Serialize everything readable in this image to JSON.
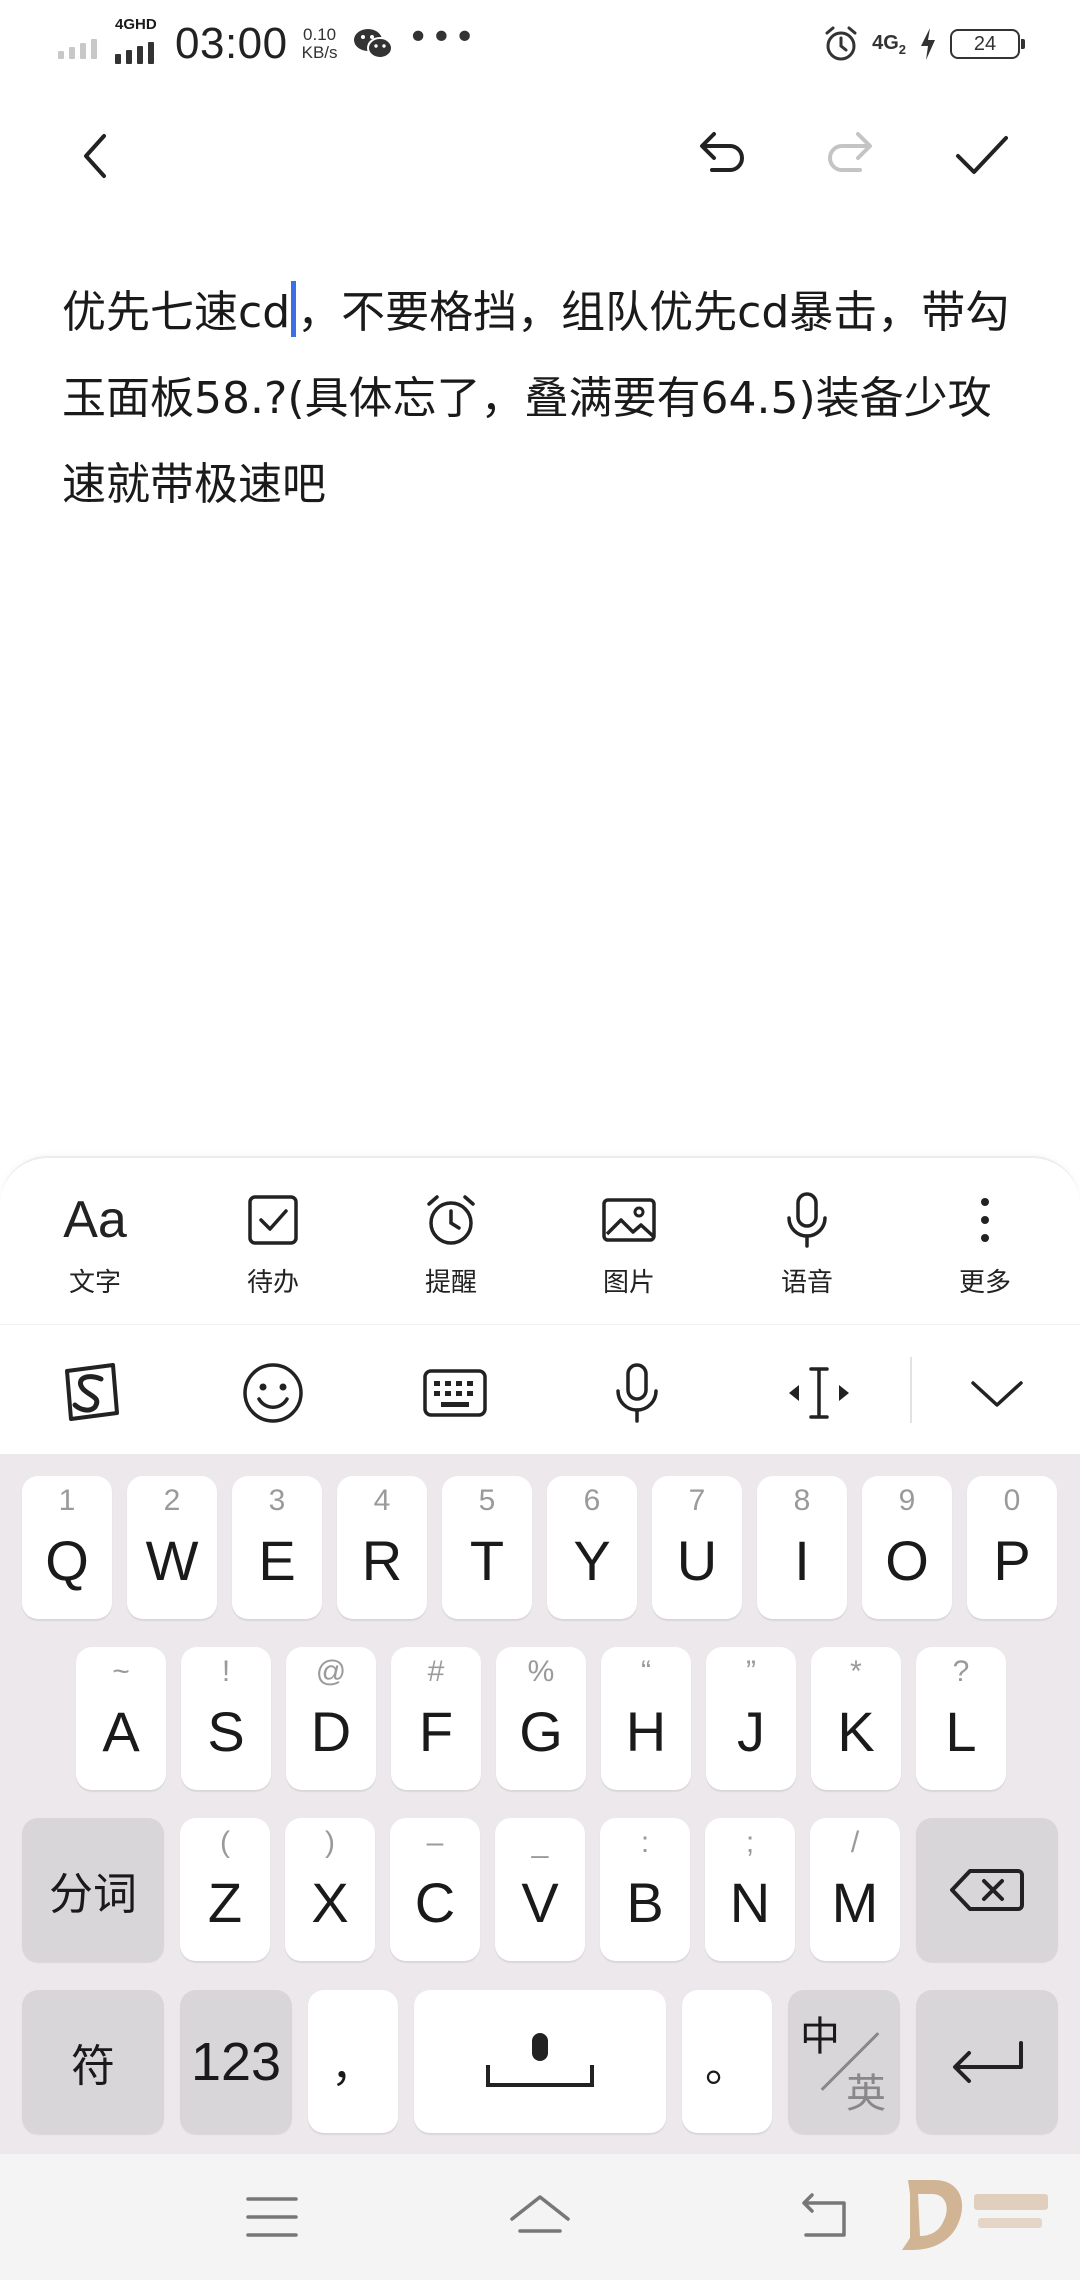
{
  "status_bar": {
    "network_tag": "4GHD",
    "time": "03:00",
    "speed_value": "0.10",
    "speed_unit": "KB/s",
    "more_indicator": "•••",
    "network_right": "4G",
    "network_right_sub": "2",
    "battery": "24",
    "icons": [
      "signal-icon",
      "wechat-icon",
      "alarm-icon",
      "charging-icon",
      "battery-icon"
    ]
  },
  "toolbar": {
    "back": "back-icon",
    "undo": "undo-icon",
    "redo": "redo-icon",
    "done": "check-icon"
  },
  "note": {
    "text_before_cursor": "优先七速cd",
    "text_after_cursor": "，不要格挡，组队优先cd暴击，带勾玉面板58.?(具体忘了，叠满要有64.5)装备少攻速就带极速吧",
    "cursor_color": "#3a6fe8"
  },
  "format_bar": {
    "items": [
      {
        "label": "文字",
        "icon": "text-style-icon",
        "glyph": "Aa"
      },
      {
        "label": "待办",
        "icon": "checkbox-icon"
      },
      {
        "label": "提醒",
        "icon": "alarm-clock-icon"
      },
      {
        "label": "图片",
        "icon": "image-icon"
      },
      {
        "label": "语音",
        "icon": "microphone-icon"
      },
      {
        "label": "更多",
        "icon": "more-vertical-icon"
      }
    ]
  },
  "keyboard_tools": [
    "sogou-logo-icon",
    "emoji-icon",
    "keyboard-icon",
    "voice-input-icon",
    "cursor-move-icon",
    "collapse-keyboard-icon"
  ],
  "keyboard": {
    "row1": [
      {
        "hint": "1",
        "key": "Q"
      },
      {
        "hint": "2",
        "key": "W"
      },
      {
        "hint": "3",
        "key": "E"
      },
      {
        "hint": "4",
        "key": "R"
      },
      {
        "hint": "5",
        "key": "T"
      },
      {
        "hint": "6",
        "key": "Y"
      },
      {
        "hint": "7",
        "key": "U"
      },
      {
        "hint": "8",
        "key": "I"
      },
      {
        "hint": "9",
        "key": "O"
      },
      {
        "hint": "0",
        "key": "P"
      }
    ],
    "row2": [
      {
        "hint": "~",
        "key": "A"
      },
      {
        "hint": "!",
        "key": "S"
      },
      {
        "hint": "@",
        "key": "D"
      },
      {
        "hint": "#",
        "key": "F"
      },
      {
        "hint": "%",
        "key": "G"
      },
      {
        "hint": "“",
        "key": "H"
      },
      {
        "hint": "”",
        "key": "J"
      },
      {
        "hint": "*",
        "key": "K"
      },
      {
        "hint": "?",
        "key": "L"
      }
    ],
    "row3": [
      {
        "hint": "(",
        "key": "Z"
      },
      {
        "hint": ")",
        "key": "X"
      },
      {
        "hint": "–",
        "key": "C"
      },
      {
        "hint": "_",
        "key": "V"
      },
      {
        "hint": ":",
        "key": "B"
      },
      {
        "hint": ";",
        "key": "N"
      },
      {
        "hint": "/",
        "key": "M"
      }
    ],
    "segment_label": "分词",
    "symbols_label": "符",
    "numbers_label": "123",
    "comma": "，",
    "period": "。",
    "lang_zh": "中",
    "lang_en": "英"
  },
  "navbar": {
    "menu": "menu-icon",
    "home": "home-icon",
    "back": "back-nav-icon",
    "watermark": "watermark-logo"
  }
}
